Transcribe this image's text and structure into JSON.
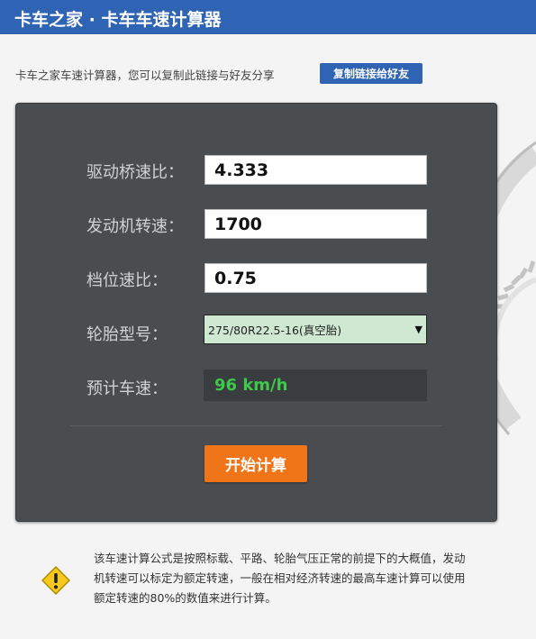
{
  "header": {
    "title": "卡车之家 · 卡车车速计算器"
  },
  "share": {
    "text": "卡车之家车速计算器，您可以复制此链接与好友分享",
    "button_label": "复制链接给好友"
  },
  "form": {
    "axle_ratio": {
      "label": "驱动桥速比：",
      "value": "4.333"
    },
    "engine_speed": {
      "label": "发动机转速：",
      "value": "1700"
    },
    "gear_ratio": {
      "label": "档位速比：",
      "value": "0.75"
    },
    "tire": {
      "label": "轮胎型号：",
      "selected": "275/80R22.5-16(真空胎)"
    },
    "result": {
      "label": "预计车速：",
      "value": "96 km/h"
    },
    "calculate_label": "开始计算"
  },
  "note": {
    "icon": "warning-icon",
    "text": "该车速计算公式是按照标载、平路、轮胎气压正常的前提下的大概值，发动机转速可以标定为额定转速，一般在相对经济转速的最高车速计算可以使用额定转速的80%的数值来进行计算。"
  },
  "colors": {
    "brand_blue": "#2f63b3",
    "panel_bg": "#4a4d4f",
    "result_green": "#3fc84a",
    "calc_orange": "#f07418",
    "select_bg": "#cfe8d2"
  }
}
